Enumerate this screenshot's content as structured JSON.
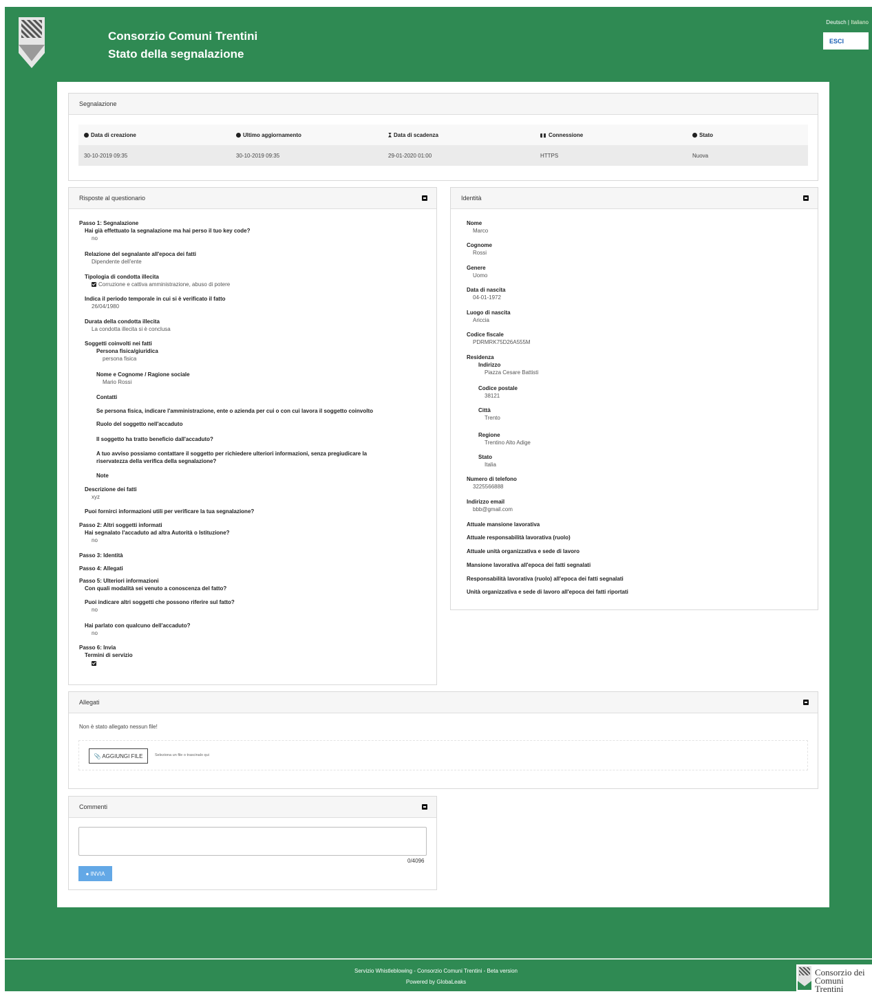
{
  "header": {
    "org": "Consorzio Comuni Trentini",
    "subtitle": "Stato della segnalazione",
    "lang_de": "Deutsch",
    "lang_it": "Italiano",
    "logout": "ESCI"
  },
  "segnalazione": {
    "title": "Segnalazione",
    "cols": [
      "Data di creazione",
      "Ultimo aggiornamento",
      "Data di scadenza",
      "Connessione",
      "Stato"
    ],
    "values": [
      "30-10-2019 09:35",
      "30-10-2019 09:35",
      "29-01-2020 01:00",
      "HTTPS",
      "Nuova"
    ]
  },
  "questionario": {
    "title": "Risposte al questionario",
    "step1": "Passo 1: Segnalazione",
    "q_keycode": "Hai già effettuato la segnalazione ma hai perso il tuo key code?",
    "a_keycode": "no",
    "q_relazione": "Relazione del segnalante all'epoca dei fatti",
    "a_relazione": "Dipendente dell'ente",
    "q_tipologia": "Tipologia di condotta illecita",
    "a_tipologia": "Corruzione e cattiva amministrazione, abuso di potere",
    "q_periodo": "Indica il periodo temporale in cui si è verificato il fatto",
    "a_periodo": "26/04/1980",
    "q_durata": "Durata della condotta illecita",
    "a_durata": "La condotta illecita si è conclusa",
    "q_soggetti": "Soggetti coinvolti nei fatti",
    "q_persona": "Persona fisica/giuridica",
    "a_persona": "persona fisica",
    "q_nome": "Nome e Cognome / Ragione sociale",
    "a_nome": "Mario Rossi",
    "q_contatti": "Contatti",
    "q_amministrazione": "Se persona fisica, indicare l'amministrazione, ente o azienda per cui o con cui lavora il soggetto coinvolto",
    "q_ruolo": "Ruolo del soggetto nell'accaduto",
    "q_beneficio": "Il soggetto ha tratto beneficio dall'accaduto?",
    "q_contattare": "A tuo avviso possiamo contattare il soggetto per richiedere ulteriori informazioni, senza pregiudicare la riservatezza della verifica della segnalazione?",
    "q_note": "Note",
    "q_descrizione": "Descrizione dei fatti",
    "a_descrizione": "xyz",
    "q_info_utili": "Puoi fornirci informazioni utili per verificare la tua segnalazione?",
    "step2": "Passo 2: Altri soggetti informati",
    "q_autorita": "Hai segnalato l'accaduto ad altra Autorità o Istituzione?",
    "a_autorita": "no",
    "step3": "Passo 3: Identità",
    "step4": "Passo 4: Allegati",
    "step5": "Passo 5: Ulteriori informazioni",
    "q_modalita": "Con quali modalità sei venuto a conoscenza del fatto?",
    "q_altri": "Puoi indicare altri soggetti che possono riferire sul fatto?",
    "a_altri": "no",
    "q_parlato": "Hai parlato con qualcuno dell'accaduto?",
    "a_parlato": "no",
    "step6": "Passo 6: Invia",
    "q_termini": "Termini di servizio"
  },
  "identita": {
    "title": "Identità",
    "nome_l": "Nome",
    "nome_v": "Marco",
    "cognome_l": "Cognome",
    "cognome_v": "Rossi",
    "genere_l": "Genere",
    "genere_v": "Uomo",
    "nascita_l": "Data di nascita",
    "nascita_v": "04-01-1972",
    "luogo_l": "Luogo di nascita",
    "luogo_v": "Ariccia",
    "cf_l": "Codice fiscale",
    "cf_v": "PDRMRK75D26A555M",
    "residenza_l": "Residenza",
    "indirizzo_l": "Indirizzo",
    "indirizzo_v": "Piazza Cesare Battisti",
    "cap_l": "Codice postale",
    "cap_v": "38121",
    "citta_l": "Città",
    "citta_v": "Trento",
    "regione_l": "Regione",
    "regione_v": "Trentino Alto Adige",
    "stato_l": "Stato",
    "stato_v": "Italia",
    "tel_l": "Numero di telefono",
    "tel_v": "3225566888",
    "email_l": "Indirizzo email",
    "email_v": "bbb@gmail.com",
    "mansione_l": "Attuale mansione lavorativa",
    "resp_l": "Attuale responsabilità lavorativa (ruolo)",
    "unita_l": "Attuale unità organizzativa e sede di lavoro",
    "mansione_ep_l": "Mansione lavorativa all'epoca dei fatti segnalati",
    "resp_ep_l": "Responsabilità lavorativa (ruolo) all'epoca dei fatti segnalati",
    "unita_ep_l": "Unità organizzativa e sede di lavoro all'epoca dei fatti riportati"
  },
  "allegati": {
    "title": "Allegati",
    "empty": "Non è stato allegato nessun file!",
    "add_button": "AGGIUNGI FILE",
    "hint": "Seleziona un file o trascinalo qui"
  },
  "commenti": {
    "title": "Commenti",
    "counter": "0/4096",
    "send": "INVIA"
  },
  "footer": {
    "line1": "Servizio Whistleblowing - Consorzio Comuni Trentini - Beta version",
    "line2": "Powered by GlobaLeaks",
    "logo_line1": "Consorzio dei",
    "logo_line2": "Comuni Trentini"
  }
}
